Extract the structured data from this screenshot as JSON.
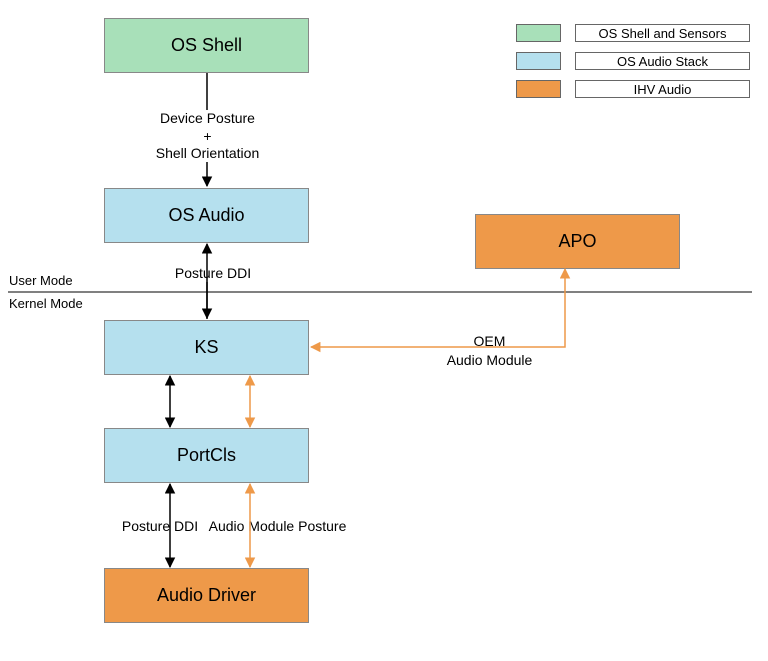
{
  "nodes": {
    "os_shell": "OS Shell",
    "os_audio": "OS Audio",
    "apo": "APO",
    "ks": "KS",
    "portcls": "PortCls",
    "audio_driver": "Audio Driver"
  },
  "labels": {
    "device_posture": "Device Posture",
    "plus": "+",
    "shell_orientation": "Shell Orientation",
    "posture_ddi_upper": "Posture DDI",
    "user_mode": "User Mode",
    "kernel_mode": "Kernel Mode",
    "oem_audio_module_l1": "OEM",
    "oem_audio_module_l2": "Audio Module",
    "posture_ddi_lower": "Posture DDI",
    "audio_module_posture": "Audio Module Posture"
  },
  "legend": {
    "shell_sensors": "OS Shell and Sensors",
    "audio_stack": "OS Audio Stack",
    "ihv_audio": "IHV Audio"
  },
  "colors": {
    "green": "#a8e0b9",
    "blue": "#b5e0ee",
    "orange": "#ee9949"
  }
}
